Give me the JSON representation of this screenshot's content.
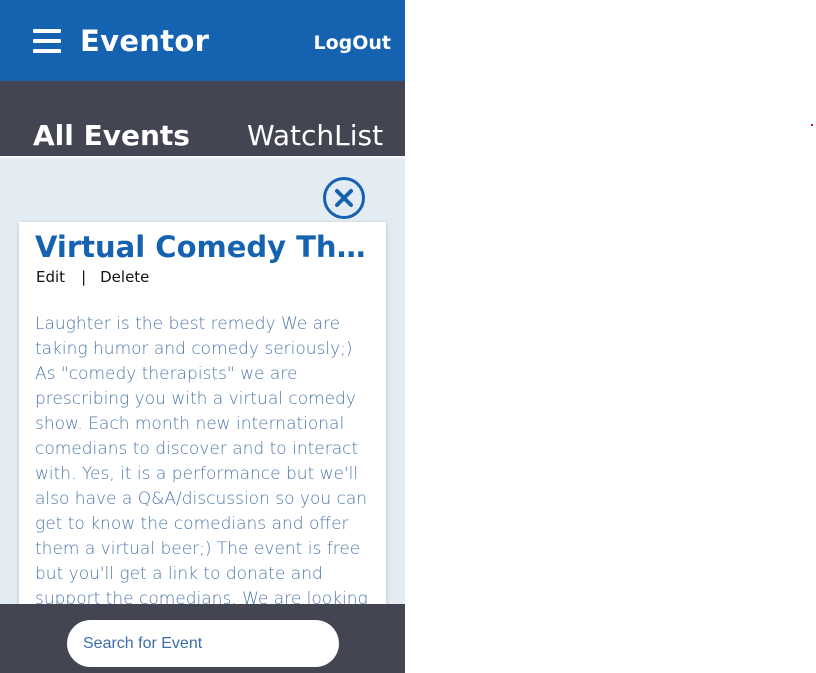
{
  "header": {
    "title": "Eventor",
    "logout_label": "LogOut"
  },
  "tabs": [
    {
      "label": "All Events",
      "active": true
    },
    {
      "label": "WatchList",
      "active": false
    }
  ],
  "event": {
    "title": "Virtual Comedy Therapy",
    "edit_label": "Edit",
    "separator": "|",
    "delete_label": "Delete",
    "description": "Laughter is the best remedy We are taking humor and comedy seriously;) As \"comedy therapists\" we are prescribing you with a virtual comedy show. Each month new international comedians to discover and to interact with. Yes, it is a performance but we'll also have a Q&A/discussion so you can get to know the comedians and offer them a virtual beer;) The event is free but you'll get a link to donate and support the comedians. We are looking forward to welcoming you to our Comedy Therapy"
  },
  "search": {
    "placeholder": "Search for Event",
    "value": ""
  },
  "icons": {
    "menu": "hamburger-menu-icon",
    "close": "close-circle-icon"
  },
  "colors": {
    "primary": "#1562b0",
    "dark": "#434552",
    "background": "#e3ebf3",
    "description_text": "#4f78a8"
  }
}
